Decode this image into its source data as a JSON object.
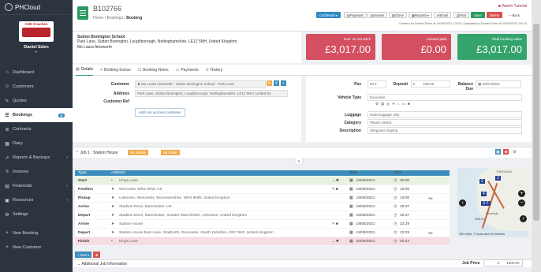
{
  "app": {
    "logo_text": "PHCloud"
  },
  "user": {
    "name": "Daniel Eden",
    "company_logo_text": "A2B Coaches"
  },
  "sidebar": {
    "items": [
      {
        "label": "Dashboard",
        "icon": "⌂"
      },
      {
        "label": "Customers",
        "icon": "☺"
      },
      {
        "label": "Quotes",
        "icon": "✎"
      },
      {
        "label": "Bookings",
        "icon": "☰",
        "badge": "8",
        "active": true
      },
      {
        "label": "Contracts",
        "icon": "≣"
      },
      {
        "label": "Diary",
        "icon": "▦"
      },
      {
        "label": "Reports & Backups",
        "icon": "↗",
        "arrow": "‹"
      },
      {
        "label": "Invoices",
        "icon": "≡"
      },
      {
        "label": "Financials",
        "icon": "▤",
        "arrow": "‹"
      },
      {
        "label": "Resources",
        "icon": "▣",
        "arrow": "‹"
      },
      {
        "label": "Settings",
        "icon": "⚙"
      },
      {
        "label": "New Booking",
        "icon": "+"
      },
      {
        "label": "New Customer",
        "icon": "+"
      }
    ]
  },
  "header": {
    "ref": "B102766",
    "breadcrumb": [
      "Home",
      "Bookings",
      "Booking"
    ],
    "watch": "Watch Tutorial",
    "buttons": {
      "confirmed": "Confirmed ▾",
      "payment": "Payment",
      "invoice": "Invoice",
      "clone": "Clone",
      "reports": "Reports ▾",
      "email": "Email",
      "print": "Print",
      "save": "Save",
      "delete": "Delete",
      "back": "Back"
    },
    "created": "Created by Daniel Eden at 19/08/2021 13:05 | Updated by Daniel Eden at 14/09/2021 08:13"
  },
  "customer": {
    "name": "Sutton Bonington School",
    "address": "Park Lane, Sutton Bonington, Loughborough, Nottinghamshire, LE12 5NH, United Kingdom",
    "contact": "Ms Laura Ainsworth"
  },
  "stats": [
    {
      "label": "Due: 20 Jul 2021",
      "value": "£3,017.00",
      "color": "#d44f5f"
    },
    {
      "label": "Amount paid",
      "value": "£0.00",
      "color": "#d44f5f"
    },
    {
      "label": "Total booking value",
      "value": "£3,017.00",
      "color": "#34a46c"
    }
  ],
  "tabs": [
    "Details",
    "Booking Extras",
    "Booking Notes",
    "Payments",
    "History"
  ],
  "form": {
    "customer_label": "Customer",
    "customer_value": "Ms Laura Ainsworth - Sutton Bonington School - Park Lane",
    "address_label": "Address",
    "address_value": "Park Lane, Sutton Bonington, Loughborough, Nottinghamshire, LE12 5NH, United Kir",
    "custref_label": "Customer Ref",
    "link_account": "Add non account customer",
    "pax_label": "Pax",
    "pax_value": "50",
    "deposit_label": "Deposit",
    "deposit_currency": "£",
    "deposit_value": "100.00",
    "balance_label": "Balance Due",
    "balance_value": "20/07/2021",
    "vehicle_label": "Vehicle Type",
    "vehicle_value": "Executive",
    "luggage_label": "Luggage",
    "luggage_value": "Hand luggage only",
    "category_label": "Category",
    "category_value": "Please Select",
    "description_label": "Description",
    "description_value": "Skegness Daytrip"
  },
  "job": {
    "title": "Job 1 : Station House",
    "tag_vehicle": "No Vehicle",
    "tag_driver": "No Driver",
    "page": "1"
  },
  "table": {
    "headers": {
      "type": "Type",
      "address": "Address",
      "date": "Date",
      "time": "Time"
    },
    "rows": [
      {
        "type": "Start",
        "address": "Kings Lane",
        "date": "19/08/2021",
        "time": "06:00",
        "kind": "start",
        "pin": "•"
      },
      {
        "type": "Position",
        "address": "Worcester WR4 9NW, UK",
        "date": "19/08/2021",
        "time": "19:00",
        "kind": "mid",
        "pin": "➤"
      },
      {
        "type": "Pickup",
        "address": "Unknown, Worcester, Worcestershire, WR4 9NW, United Kingdom",
        "date": "19/08/2021",
        "time": "19:00",
        "kind": "mid",
        "pin": "➤",
        "extra": "⚙▾"
      },
      {
        "type": "Arrive",
        "address": "Stadium Drive, Manchester, UK",
        "date": "19/08/2021",
        "time": "20:37",
        "kind": "mid",
        "pin": "➤"
      },
      {
        "type": "Depart",
        "address": "Stadium Drive, Manchester, Greater Manchester, Unknown, United Kingdom",
        "date": "19/08/2021",
        "time": "20:37",
        "kind": "mid",
        "pin": "➤"
      },
      {
        "type": "Arrive",
        "address": "Station House",
        "date": "19/08/2021",
        "time": "22:29",
        "kind": "mid",
        "pin": "➤"
      },
      {
        "type": "Depart",
        "address": "Station House East Lane, Staithorth, Doncaster, South Yorkshire, DN7 5HF, United Kingdom",
        "date": "19/08/2021",
        "time": "22:29",
        "kind": "mid",
        "pin": "➤",
        "extra": "⚙▾"
      },
      {
        "type": "Finish",
        "address": "Kings Lane",
        "date": "20/08/2021",
        "time": "00:44",
        "kind": "finish",
        "pin": "•"
      }
    ],
    "new_btn": "New ▾"
  },
  "map": {
    "info": "330 miles, 7 hours and 45 minutes",
    "labels": [
      "ENGLAND",
      "Birmingh",
      "WALES"
    ]
  },
  "additional": "Additional Job Information",
  "price": {
    "label": "Job Price",
    "currency": "£",
    "value": "1500.00"
  }
}
